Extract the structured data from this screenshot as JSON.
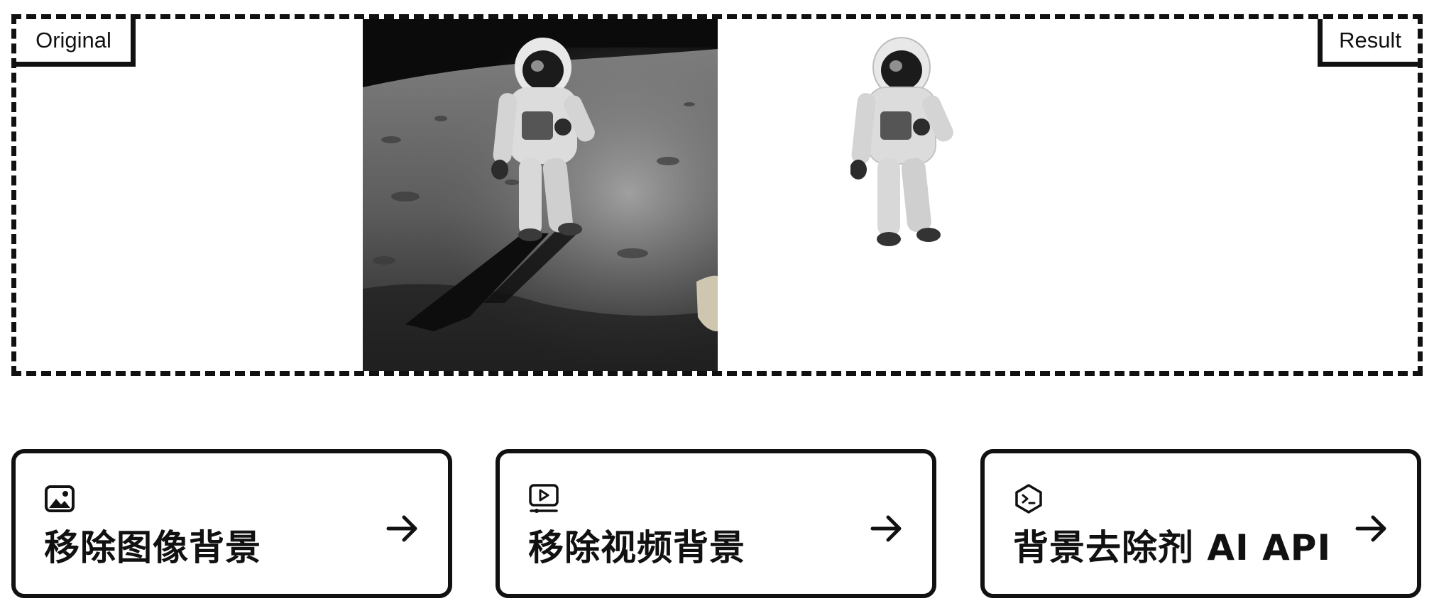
{
  "comparison": {
    "original_label": "Original",
    "result_label": "Result"
  },
  "cards": [
    {
      "icon": "image-icon",
      "title": "移除图像背景"
    },
    {
      "icon": "video-play-icon",
      "title": "移除视频背景"
    },
    {
      "icon": "terminal-hexagon-icon",
      "title": "背景去除剂 AI API"
    }
  ],
  "colors": {
    "border": "#111111",
    "background": "#ffffff"
  }
}
